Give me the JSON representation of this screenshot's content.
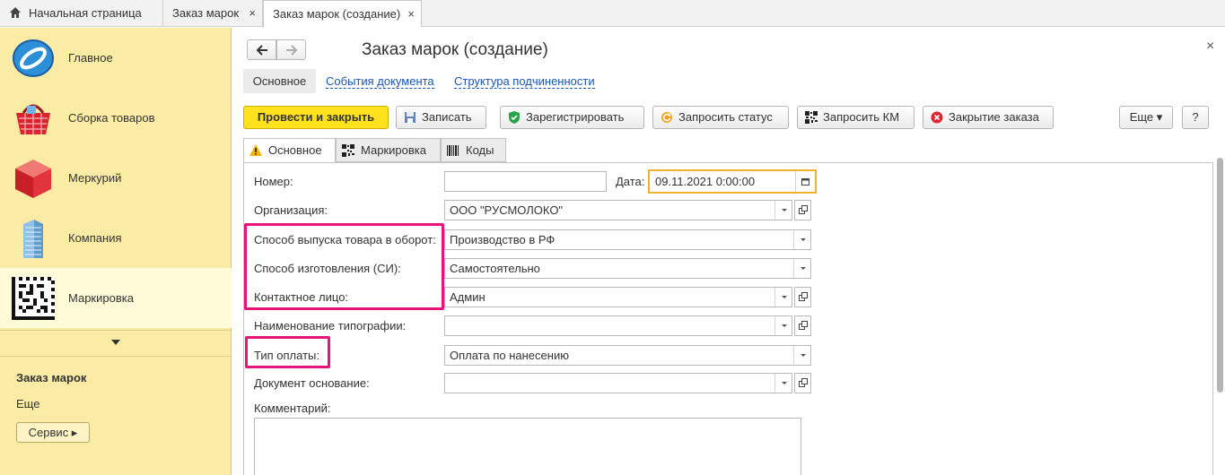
{
  "tabs": {
    "home": "Начальная страница",
    "order": "Заказ марок",
    "order_create": "Заказ марок (создание)",
    "close_glyph": "×"
  },
  "sidebar": {
    "items": [
      {
        "label": "Главное",
        "icon": "globe-icon"
      },
      {
        "label": "Сборка товаров",
        "icon": "basket-icon"
      },
      {
        "label": "Меркурий",
        "icon": "cube-icon"
      },
      {
        "label": "Компания",
        "icon": "building-icon"
      },
      {
        "label": "Маркировка",
        "icon": "datamatrix-icon",
        "active": true
      }
    ],
    "section_title": "Заказ марок",
    "more": "Еще",
    "service_button": "Сервис ▸"
  },
  "document": {
    "title": "Заказ марок (создание)",
    "link_tabs": [
      "Основное",
      "События документа",
      "Структура подчиненности"
    ],
    "toolbar": {
      "post_close": "Провести и закрыть",
      "save": "Записать",
      "register": "Зарегистрировать",
      "request_status": "Запросить статус",
      "request_km": "Запросить КМ",
      "close_order": "Закрытие заказа",
      "more": "Еще ▾",
      "help": "?"
    },
    "form_tabs": [
      "Основное",
      "Маркировка",
      "Коды"
    ],
    "fields": {
      "number_label": "Номер:",
      "number_value": "",
      "date_label": "Дата:",
      "date_value": "09.11.2021  0:00:00",
      "organization_label": "Организация:",
      "organization_value": "ООО \"РУСМОЛОКО\"",
      "release_method_label": "Способ выпуска товара в оборот:",
      "release_method_value": "Производство в РФ",
      "production_method_label": "Способ изготовления (СИ):",
      "production_method_value": "Самостоятельно",
      "contact_label": "Контактное лицо:",
      "contact_value": "Админ",
      "printing_house_label": "Наименование типографии:",
      "printing_house_value": "",
      "payment_type_label": "Тип оплаты:",
      "payment_type_value": "Оплата по нанесению",
      "base_document_label": "Документ основание:",
      "base_document_value": "",
      "comment_label": "Комментарий:",
      "comment_value": ""
    }
  },
  "colors": {
    "sidebar_bg": "#fbeca5",
    "primary_button": "#ffe11e",
    "highlight": "#e8147b",
    "date_focus": "#f0b232",
    "link": "#1a56b4"
  }
}
